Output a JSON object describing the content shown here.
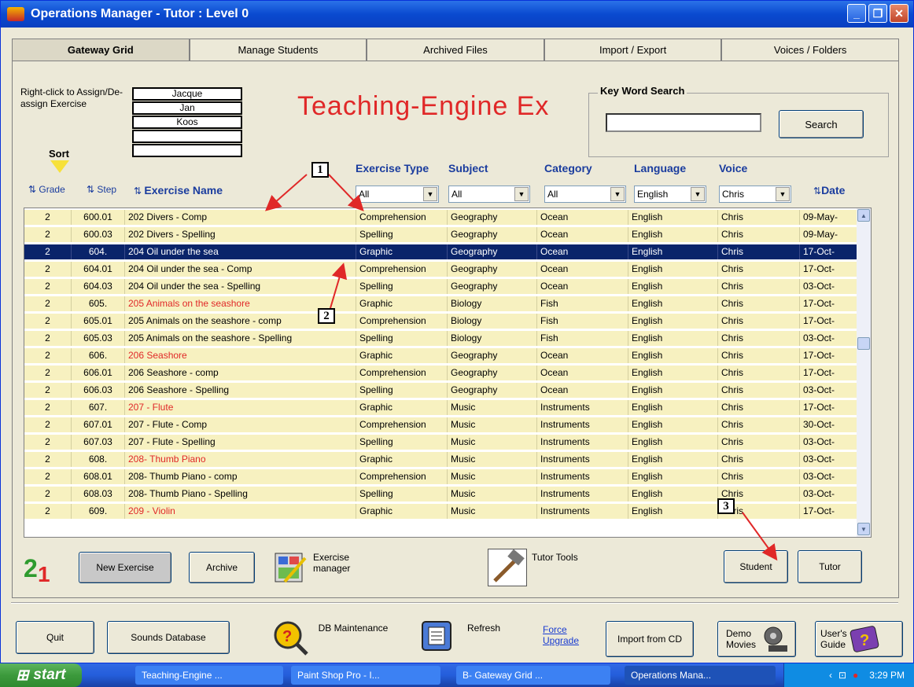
{
  "window": {
    "title": "Operations Manager - Tutor  :  Level 0"
  },
  "tabs": [
    "Gateway Grid",
    "Manage Students",
    "Archived Files",
    "Import / Export",
    "Voices / Folders"
  ],
  "assign": {
    "hint": "Right-click to Assign/De-assign Exercise",
    "students": [
      "Jacque",
      "Jan",
      "Koos",
      "",
      ""
    ]
  },
  "sort_label": "Sort",
  "heading": "Teaching-Engine Ex",
  "keyword_search": {
    "title": "Key Word Search",
    "value": "",
    "button": "Search"
  },
  "columns": {
    "grade": "Grade",
    "step": "Step",
    "exercise_name": "Exercise Name",
    "exercise_type": "Exercise Type",
    "subject": "Subject",
    "category": "Category",
    "language": "Language",
    "voice": "Voice",
    "date": "Date"
  },
  "filters": {
    "exercise_type": "All",
    "subject": "All",
    "category": "All",
    "language": "English",
    "voice": "Chris"
  },
  "rows": [
    {
      "grade": "2",
      "step": "600.01",
      "name": "202 Divers - Comp",
      "type": "Comprehension",
      "subject": "Geography",
      "category": "Ocean",
      "language": "English",
      "voice": "Chris",
      "date": "09-May-"
    },
    {
      "grade": "2",
      "step": "600.03",
      "name": "202 Divers - Spelling",
      "type": "Spelling",
      "subject": "Geography",
      "category": "Ocean",
      "language": "English",
      "voice": "Chris",
      "date": "09-May-"
    },
    {
      "grade": "2",
      "step": "604.",
      "name": "204 Oil under the sea",
      "type": "Graphic",
      "subject": "Geography",
      "category": "Ocean",
      "language": "English",
      "voice": "Chris",
      "date": "17-Oct-"
    },
    {
      "grade": "2",
      "step": "604.01",
      "name": "204 Oil under the sea - Comp",
      "type": "Comprehension",
      "subject": "Geography",
      "category": "Ocean",
      "language": "English",
      "voice": "Chris",
      "date": "17-Oct-"
    },
    {
      "grade": "2",
      "step": "604.03",
      "name": "204 Oil under the sea - Spelling",
      "type": "Spelling",
      "subject": "Geography",
      "category": "Ocean",
      "language": "English",
      "voice": "Chris",
      "date": "03-Oct-"
    },
    {
      "grade": "2",
      "step": "605.",
      "name": "205 Animals on the seashore",
      "type": "Graphic",
      "subject": "Biology",
      "category": "Fish",
      "language": "English",
      "voice": "Chris",
      "date": "17-Oct-"
    },
    {
      "grade": "2",
      "step": "605.01",
      "name": "205  Animals on the seashore - comp",
      "type": "Comprehension",
      "subject": "Biology",
      "category": "Fish",
      "language": "English",
      "voice": "Chris",
      "date": "17-Oct-"
    },
    {
      "grade": "2",
      "step": "605.03",
      "name": "205  Animals on the seashore - Spelling",
      "type": "Spelling",
      "subject": "Biology",
      "category": "Fish",
      "language": "English",
      "voice": "Chris",
      "date": "03-Oct-"
    },
    {
      "grade": "2",
      "step": "606.",
      "name": "206  Seashore",
      "type": "Graphic",
      "subject": "Geography",
      "category": "Ocean",
      "language": "English",
      "voice": "Chris",
      "date": "17-Oct-"
    },
    {
      "grade": "2",
      "step": "606.01",
      "name": "206  Seashore - comp",
      "type": "Comprehension",
      "subject": "Geography",
      "category": "Ocean",
      "language": "English",
      "voice": "Chris",
      "date": "17-Oct-"
    },
    {
      "grade": "2",
      "step": "606.03",
      "name": "206  Seashore - Spelling",
      "type": "Spelling",
      "subject": "Geography",
      "category": "Ocean",
      "language": "English",
      "voice": "Chris",
      "date": "03-Oct-"
    },
    {
      "grade": "2",
      "step": "607.",
      "name": "207 - Flute",
      "type": "Graphic",
      "subject": "Music",
      "category": "Instruments",
      "language": "English",
      "voice": "Chris",
      "date": "17-Oct-"
    },
    {
      "grade": "2",
      "step": "607.01",
      "name": "207 - Flute - Comp",
      "type": "Comprehension",
      "subject": "Music",
      "category": "Instruments",
      "language": "English",
      "voice": "Chris",
      "date": "30-Oct-"
    },
    {
      "grade": "2",
      "step": "607.03",
      "name": "207 - Flute - Spelling",
      "type": "Spelling",
      "subject": "Music",
      "category": "Instruments",
      "language": "English",
      "voice": "Chris",
      "date": "03-Oct-"
    },
    {
      "grade": "2",
      "step": "608.",
      "name": "208- Thumb Piano",
      "type": "Graphic",
      "subject": "Music",
      "category": "Instruments",
      "language": "English",
      "voice": "Chris",
      "date": "03-Oct-"
    },
    {
      "grade": "2",
      "step": "608.01",
      "name": "208- Thumb Piano - comp",
      "type": "Comprehension",
      "subject": "Music",
      "category": "Instruments",
      "language": "English",
      "voice": "Chris",
      "date": "03-Oct-"
    },
    {
      "grade": "2",
      "step": "608.03",
      "name": "208- Thumb Piano - Spelling",
      "type": "Spelling",
      "subject": "Music",
      "category": "Instruments",
      "language": "English",
      "voice": "Chris",
      "date": "03-Oct-"
    },
    {
      "grade": "2",
      "step": "609.",
      "name": "209 - Violin",
      "type": "Graphic",
      "subject": "Music",
      "category": "Instruments",
      "language": "English",
      "voice": "Chris",
      "date": "17-Oct-"
    }
  ],
  "selected_row": 2,
  "actions": {
    "new_exercise": "New Exercise",
    "archive": "Archive",
    "exercise_manager": "Exercise manager",
    "tutor_tools": "Tutor Tools",
    "student": "Student",
    "tutor": "Tutor"
  },
  "bottom": {
    "quit": "Quit",
    "sounds_database": "Sounds Database",
    "db_maintenance": "DB Maintenance",
    "refresh": "Refresh",
    "force_upgrade": "Force Upgrade",
    "import_from_cd": "Import from CD",
    "demo_movies": "Demo Movies",
    "users_guide": "User's Guide"
  },
  "callouts": [
    "1",
    "2",
    "3"
  ],
  "taskbar": {
    "start": "start",
    "items": [
      "Teaching-Engine ...",
      "Paint Shop Pro - I...",
      "B- Gateway Grid ...",
      "Operations Mana..."
    ],
    "clock": "3:29 PM"
  },
  "colors": {
    "title_red": "#e02828",
    "header_blue": "#1a3c9e",
    "row_bg": "#f7f1c0",
    "selected_bg": "#0a246a",
    "callout_arrow": "#e02828"
  }
}
